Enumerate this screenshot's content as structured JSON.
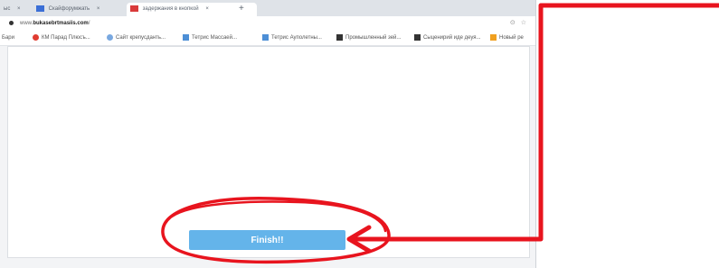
{
  "tabs": [
    {
      "label": "ыс",
      "close": "×"
    },
    {
      "label": "Скайфорумжать",
      "close": "×"
    },
    {
      "label": "задержания в кнопкой",
      "close": "×"
    }
  ],
  "new_tab": "+",
  "address": {
    "prefix": "www.",
    "domain": "bukasebrtmasiis.com",
    "suffix": "/"
  },
  "address_icons": "⊙ ☆",
  "bookmarks": [
    {
      "label": "Бари"
    },
    {
      "label": "КМ Парад Плюсъ..."
    },
    {
      "label": "Сайт крепусданть..."
    },
    {
      "label": "Тетрис Массаей..."
    },
    {
      "label": "Тетрис Ауполетны..."
    },
    {
      "label": "Промышленный зей..."
    },
    {
      "label": "Сыценирий иде деуя..."
    },
    {
      "label": "Новый ре"
    }
  ],
  "finish_button": {
    "label": "Finish!!"
  },
  "colors": {
    "annotation": "#e8141e",
    "button": "#64b4ea"
  }
}
